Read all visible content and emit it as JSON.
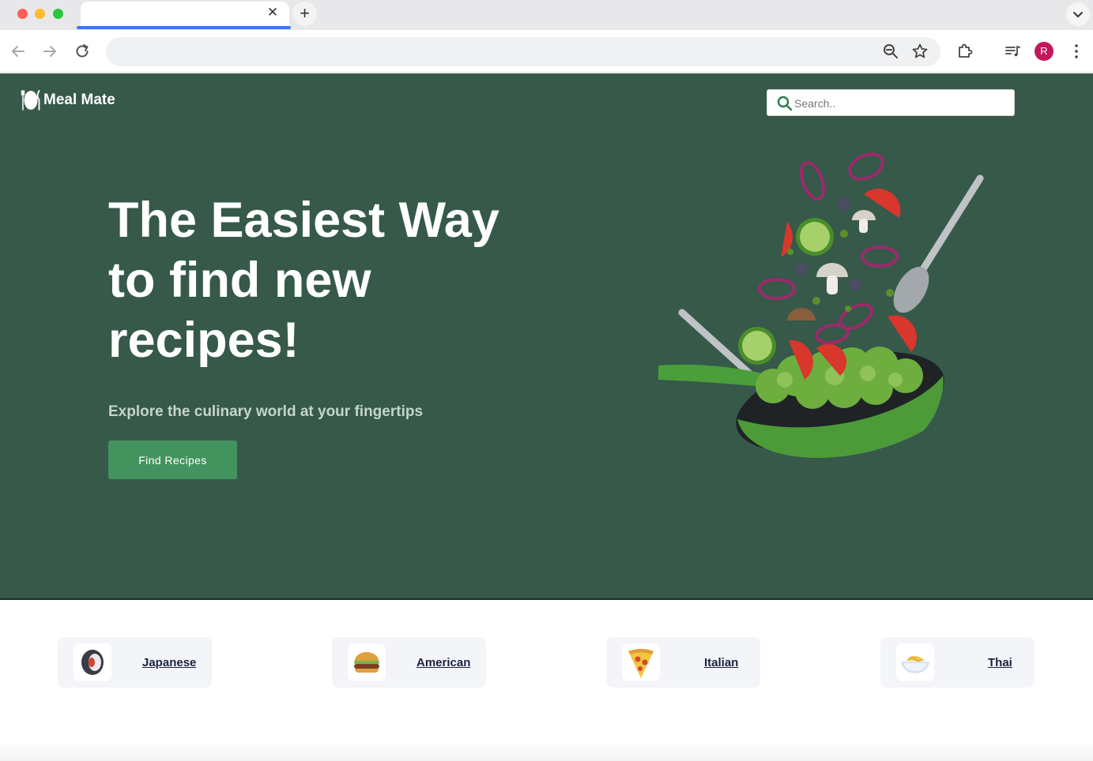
{
  "browser": {
    "tab_title": "",
    "tab_close_glyph": "✕",
    "new_tab_glyph": "+",
    "address": "",
    "profile_initial": "R",
    "accent_color": "#3b78e7",
    "profile_color": "#c2185b"
  },
  "site": {
    "brand": "Meal Mate",
    "search_placeholder": "Search..",
    "hero_title": "The Easiest Way to find new recipes!",
    "hero_subtitle": "Explore the culinary world at your fingertips",
    "cta_label": "Find Recipes",
    "hero_bg": "#36594a",
    "cta_color": "#43935f"
  },
  "categories": [
    {
      "label": "Japanese",
      "icon": "sushi-roll-icon"
    },
    {
      "label": "American",
      "icon": "burger-icon"
    },
    {
      "label": "Italian",
      "icon": "pizza-slice-icon"
    },
    {
      "label": "Thai",
      "icon": "noodle-bowl-icon"
    }
  ]
}
